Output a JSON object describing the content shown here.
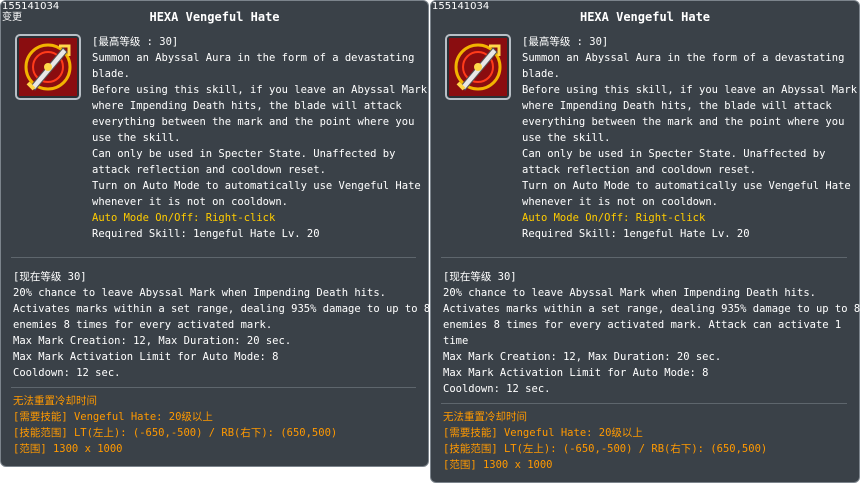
{
  "tooltips": [
    {
      "id_text": "155141034",
      "changed_text": "变更",
      "title": "HEXA Vengeful Hate",
      "icon": "vengeful-hate-skill-icon",
      "desc_lines": [
        "[最高等级 : 30]",
        "Summon an Abyssal Aura in the form of a devastating",
        "blade.",
        "Before using this skill, if you leave an Abyssal Mark",
        "where Impending Death hits, the blade will attack",
        "everything between the mark and the point where you",
        "use the skill.",
        "Can only be used in Specter State. Unaffected by",
        "attack reflection and cooldown reset.",
        "Turn on Auto Mode to automatically use Vengeful Hate",
        "whenever it is not on cooldown."
      ],
      "auto_mode_text": "Auto Mode On/Off: Right-click",
      "required_skill_text": "Required Skill: 1engeful Hate Lv. 20",
      "level_lines": [
        "[现在等级 30]",
        "20% chance to leave Abyssal Mark when Impending Death hits.",
        "Activates marks within a set range, dealing 935% damage to up to 8",
        "enemies 8 times for every activated mark.",
        "Max Mark Creation: 12, Max Duration: 20 sec.",
        "Max Mark Activation Limit for Auto Mode: 8",
        "Cooldown: 12 sec."
      ],
      "info_lines": [
        "无法重置冷却时间",
        "[需要技能] Vengeful Hate: 20级以上",
        "[技能范围] LT(左上): (-650,-500) / RB(右下): (650,500)",
        "[范围] 1300 x 1000"
      ]
    },
    {
      "id_text": "155141034",
      "title": "HEXA Vengeful Hate",
      "icon": "vengeful-hate-skill-icon",
      "desc_lines": [
        "[最高等级 : 30]",
        "Summon an Abyssal Aura in the form of a devastating",
        "blade.",
        "Before using this skill, if you leave an Abyssal Mark",
        "where Impending Death hits, the blade will attack",
        "everything between the mark and the point where you",
        "use the skill.",
        "Can only be used in Specter State. Unaffected by",
        "attack reflection and cooldown reset.",
        "Turn on Auto Mode to automatically use Vengeful Hate",
        "whenever it is not on cooldown."
      ],
      "auto_mode_text": "Auto Mode On/Off: Right-click",
      "required_skill_text": "Required Skill: 1engeful Hate Lv. 20",
      "level_lines": [
        "[现在等级 30]",
        "20% chance to leave Abyssal Mark when Impending Death hits.",
        "Activates marks within a set range, dealing 935% damage to up to 8",
        "enemies 8 times for every activated mark. Attack can activate 1",
        "time",
        "Max Mark Creation: 12, Max Duration: 20 sec.",
        "Max Mark Activation Limit for Auto Mode: 8",
        "Cooldown: 12 sec."
      ],
      "info_lines": [
        "无法重置冷却时间",
        "[需要技能] Vengeful Hate: 20级以上",
        "[技能范围] LT(左上): (-650,-500) / RB(右下): (650,500)",
        "[范围] 1300 x 1000"
      ]
    }
  ],
  "colors": {
    "background": "#3a4148",
    "text": "#ffffff",
    "auto_mode": "#ffcc00",
    "info": "#ff9900",
    "divider": "#5e666d"
  }
}
